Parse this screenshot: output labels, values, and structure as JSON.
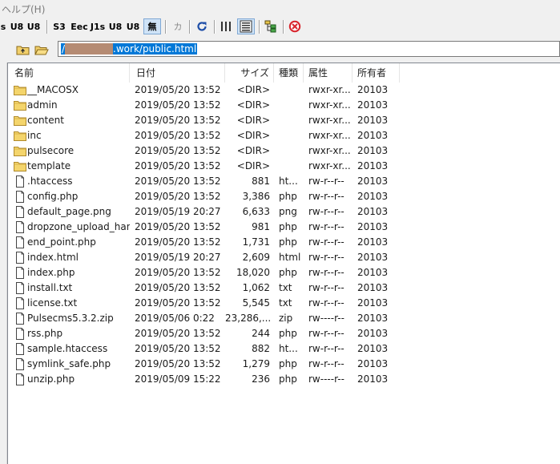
{
  "menu": {
    "help": "ヘルプ(H)"
  },
  "toolbar": {
    "buttons": [
      {
        "label": "s"
      },
      {
        "label": "U8"
      },
      {
        "label": "U8"
      },
      {
        "label": "S3"
      },
      {
        "label": "Eec"
      },
      {
        "label": "J1s"
      },
      {
        "label": "U8"
      },
      {
        "label": "U8"
      },
      {
        "label": "無"
      },
      {
        "label": "カ"
      }
    ],
    "icons": [
      "refresh-icon",
      "list-view-icon",
      "detail-view-icon",
      "tree-view-icon",
      "stop-icon"
    ]
  },
  "path": {
    "value_suffix": ".work/public.html",
    "leading": "/"
  },
  "columns": [
    "名前",
    "日付",
    "サイズ",
    "種類",
    "属性",
    "所有者"
  ],
  "files": [
    {
      "name": "__MACOSX",
      "date": "2019/05/20 13:52",
      "size": "<DIR>",
      "type": "",
      "attr": "rwxr-xr...",
      "owner": "20103",
      "icon": "folder"
    },
    {
      "name": "admin",
      "date": "2019/05/20 13:52",
      "size": "<DIR>",
      "type": "",
      "attr": "rwxr-xr...",
      "owner": "20103",
      "icon": "folder"
    },
    {
      "name": "content",
      "date": "2019/05/20 13:52",
      "size": "<DIR>",
      "type": "",
      "attr": "rwxr-xr...",
      "owner": "20103",
      "icon": "folder"
    },
    {
      "name": "inc",
      "date": "2019/05/20 13:52",
      "size": "<DIR>",
      "type": "",
      "attr": "rwxr-xr...",
      "owner": "20103",
      "icon": "folder"
    },
    {
      "name": "pulsecore",
      "date": "2019/05/20 13:52",
      "size": "<DIR>",
      "type": "",
      "attr": "rwxr-xr...",
      "owner": "20103",
      "icon": "folder"
    },
    {
      "name": "template",
      "date": "2019/05/20 13:52",
      "size": "<DIR>",
      "type": "",
      "attr": "rwxr-xr...",
      "owner": "20103",
      "icon": "folder"
    },
    {
      "name": ".htaccess",
      "date": "2019/05/20 13:52",
      "size": "881",
      "type": "ht...",
      "attr": "rw-r--r--",
      "owner": "20103",
      "icon": "file"
    },
    {
      "name": "config.php",
      "date": "2019/05/20 13:52",
      "size": "3,386",
      "type": "php",
      "attr": "rw-r--r--",
      "owner": "20103",
      "icon": "file"
    },
    {
      "name": "default_page.png",
      "date": "2019/05/19 20:27",
      "size": "6,633",
      "type": "png",
      "attr": "rw-r--r--",
      "owner": "20103",
      "icon": "file"
    },
    {
      "name": "dropzone_upload_han...",
      "date": "2019/05/20 13:52",
      "size": "981",
      "type": "php",
      "attr": "rw-r--r--",
      "owner": "20103",
      "icon": "file"
    },
    {
      "name": "end_point.php",
      "date": "2019/05/20 13:52",
      "size": "1,731",
      "type": "php",
      "attr": "rw-r--r--",
      "owner": "20103",
      "icon": "file"
    },
    {
      "name": "index.html",
      "date": "2019/05/19 20:27",
      "size": "2,609",
      "type": "html",
      "attr": "rw-r--r--",
      "owner": "20103",
      "icon": "file"
    },
    {
      "name": "index.php",
      "date": "2019/05/20 13:52",
      "size": "18,020",
      "type": "php",
      "attr": "rw-r--r--",
      "owner": "20103",
      "icon": "file"
    },
    {
      "name": "install.txt",
      "date": "2019/05/20 13:52",
      "size": "1,062",
      "type": "txt",
      "attr": "rw-r--r--",
      "owner": "20103",
      "icon": "file"
    },
    {
      "name": "license.txt",
      "date": "2019/05/20 13:52",
      "size": "5,545",
      "type": "txt",
      "attr": "rw-r--r--",
      "owner": "20103",
      "icon": "file"
    },
    {
      "name": "Pulsecms5.3.2.zip",
      "date": "2019/05/06 0:22",
      "size": "23,286,...",
      "type": "zip",
      "attr": "rw----r--",
      "owner": "20103",
      "icon": "file"
    },
    {
      "name": "rss.php",
      "date": "2019/05/20 13:52",
      "size": "244",
      "type": "php",
      "attr": "rw-r--r--",
      "owner": "20103",
      "icon": "file"
    },
    {
      "name": "sample.htaccess",
      "date": "2019/05/20 13:52",
      "size": "882",
      "type": "ht...",
      "attr": "rw-r--r--",
      "owner": "20103",
      "icon": "file"
    },
    {
      "name": "symlink_safe.php",
      "date": "2019/05/20 13:52",
      "size": "1,279",
      "type": "php",
      "attr": "rw-r--r--",
      "owner": "20103",
      "icon": "file"
    },
    {
      "name": "unzip.php",
      "date": "2019/05/09 15:22",
      "size": "236",
      "type": "php",
      "attr": "rw----r--",
      "owner": "20103",
      "icon": "file"
    }
  ]
}
